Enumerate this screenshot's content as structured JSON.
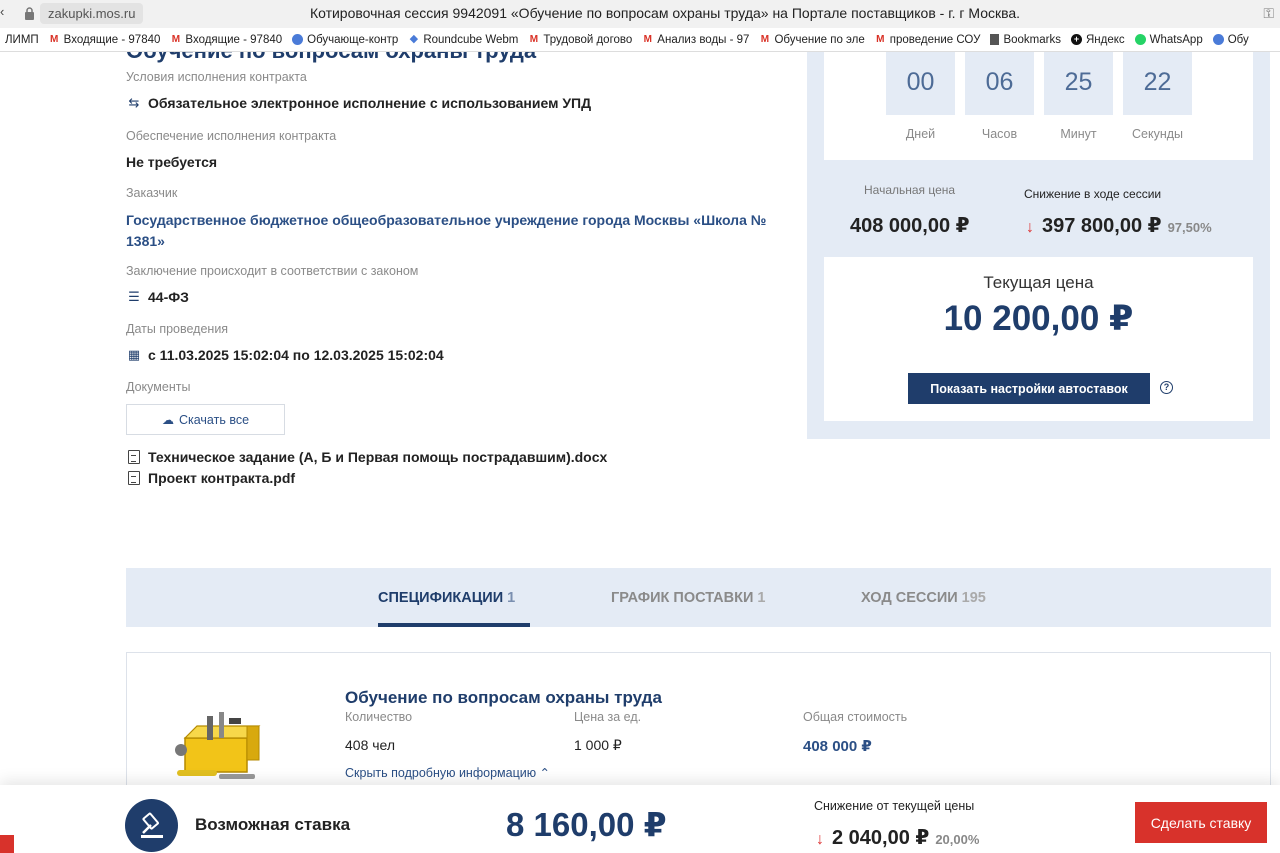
{
  "browser": {
    "back_glyph": "‹",
    "url": "zakupki.mos.ru",
    "title": "Котировочная сессия 9942091 «Обучение по вопросам охраны труда» на Портале поставщиков - г. г Москва.",
    "bookmarks": [
      {
        "label": "ЛИМП",
        "icon": "none"
      },
      {
        "label": "Входящие - 97840",
        "icon": "gmail-icon"
      },
      {
        "label": "Входящие - 97840",
        "icon": "gmail-icon"
      },
      {
        "label": "Обучающе-контр",
        "icon": "globe-icon"
      },
      {
        "label": "Roundcube Webm",
        "icon": "roundcube-icon"
      },
      {
        "label": "Трудовой догово",
        "icon": "gmail-icon"
      },
      {
        "label": "Анализ воды - 97",
        "icon": "gmail-icon"
      },
      {
        "label": "Обучение по эле",
        "icon": "gmail-icon"
      },
      {
        "label": "проведение СОУ",
        "icon": "gmail-icon"
      },
      {
        "label": "Bookmarks",
        "icon": "bookmark-icon"
      },
      {
        "label": "Яндекс",
        "icon": "yandex-icon"
      },
      {
        "label": "WhatsApp",
        "icon": "whatsapp-icon"
      },
      {
        "label": "Обу",
        "icon": "globe-icon"
      }
    ]
  },
  "header": {
    "cut_title": "Обучение по вопросам охраны труда"
  },
  "details": {
    "conditions_label": "Условия исполнения контракта",
    "conditions_value": "Обязательное электронное исполнение с использованием УПД",
    "security_label": "Обеспечение исполнения контракта",
    "security_value": "Не требуется",
    "customer_label": "Заказчик",
    "customer_value": "Государственное бюджетное общеобразовательное учреждение города Москвы «Школа № 1381»",
    "law_label": "Заключение происходит в соответствии с законом",
    "law_value": "44-ФЗ",
    "dates_label": "Даты проведения",
    "dates_value": "с 11.03.2025 15:02:04 по 12.03.2025 15:02:04",
    "documents_label": "Документы",
    "download_all": "Скачать все",
    "documents": [
      "Техническое задание (А, Б и Первая помощь пострадавшим).docx",
      "Проект контракта.pdf"
    ]
  },
  "timer": {
    "days": "00",
    "days_label": "Дней",
    "hours": "06",
    "hours_label": "Часов",
    "minutes": "25",
    "minutes_label": "Минут",
    "seconds": "22",
    "seconds_label": "Секунды"
  },
  "prices": {
    "initial_label": "Начальная цена",
    "initial_value": "408 000,00 ₽",
    "decrease_label": "Снижение в ходе сессии",
    "decrease_value": "397 800,00 ₽",
    "decrease_pct": "97,50%",
    "current_label": "Текущая цена",
    "current_value": "10 200,00 ₽",
    "autobid_button": "Показать настройки автоставок",
    "help_glyph": "?"
  },
  "tabs": [
    {
      "label": "СПЕЦИФИКАЦИИ",
      "count": "1"
    },
    {
      "label": "ГРАФИК ПОСТАВКИ",
      "count": "1"
    },
    {
      "label": "ХОД СЕССИИ",
      "count": "195"
    }
  ],
  "spec": {
    "title": "Обучение по вопросам охраны труда",
    "qty_label": "Количество",
    "qty_value": "408 чел",
    "unit_price_label": "Цена за ед.",
    "unit_price_value": "1 000 ₽",
    "total_label": "Общая стоимость",
    "total_value": "408 000 ₽",
    "hide_link": "Скрыть подробную информацию ⌃"
  },
  "bottom": {
    "possible_bid_label": "Возможная ставка",
    "possible_bid_value": "8 160,00 ₽",
    "decrease_label": "Снижение от текущей цены",
    "decrease_value": "2 040,00 ₽",
    "decrease_pct": "20,00%",
    "bid_button": "Сделать ставку"
  },
  "colors": {
    "brand": "#1f3d6b",
    "panel": "#e4ebf5",
    "accent_red": "#d8322b",
    "down_arrow": "#d33333"
  }
}
